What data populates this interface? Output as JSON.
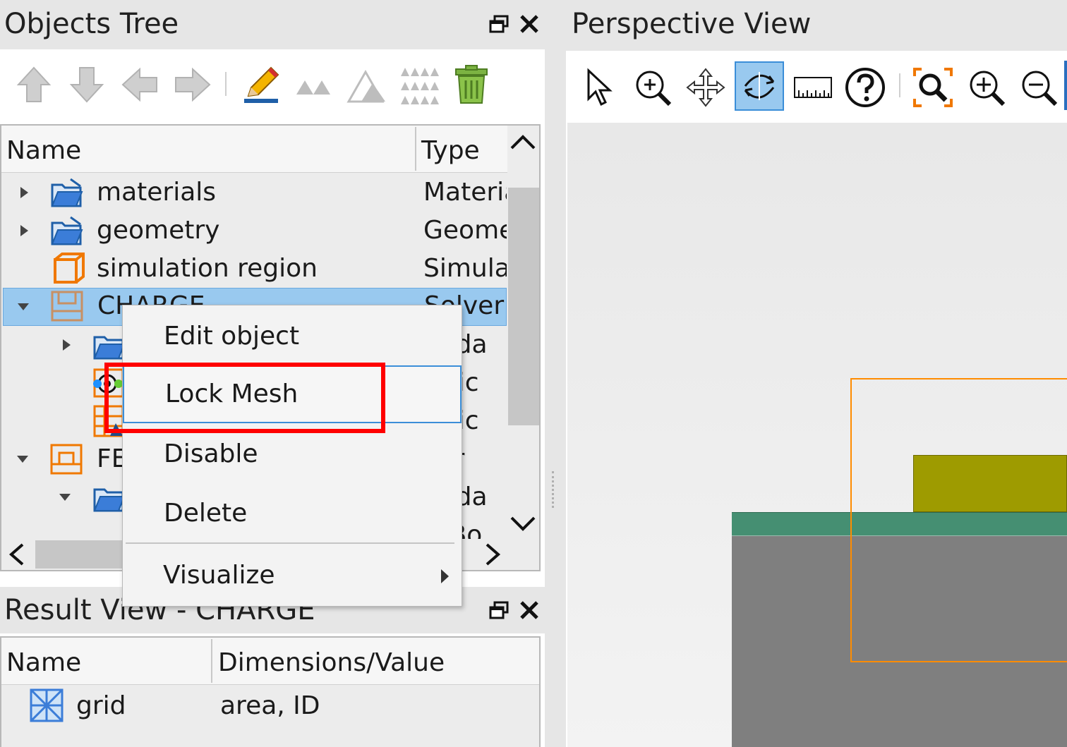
{
  "objects_tree": {
    "title": "Objects Tree",
    "toolbar": [
      {
        "icon": "arrow-up-icon"
      },
      {
        "icon": "arrow-down-icon"
      },
      {
        "icon": "arrow-left-icon"
      },
      {
        "icon": "arrow-right-icon"
      },
      {
        "icon": "edit-pencil-icon"
      },
      {
        "icon": "group-small-icon"
      },
      {
        "icon": "group-large-icon"
      },
      {
        "icon": "array-icon"
      },
      {
        "icon": "trash-icon"
      }
    ],
    "columns": {
      "name": "Name",
      "type": "Type"
    },
    "rows": [
      {
        "name": "materials",
        "type": "Materia"
      },
      {
        "name": "geometry",
        "type": "Geome"
      },
      {
        "name": "simulation region",
        "type": "Simula"
      },
      {
        "name": "CHARGE",
        "type": "Solver"
      },
      {
        "name": "",
        "type": "unda"
      },
      {
        "name": "",
        "type": "ctric"
      },
      {
        "name": "",
        "type": "ctric"
      },
      {
        "name": "FE",
        "type": "ver"
      },
      {
        "name": "",
        "type": "unda"
      },
      {
        "name": "",
        "type": "C Bo"
      }
    ]
  },
  "context_menu": {
    "items": [
      "Edit object",
      "Lock Mesh",
      "Disable",
      "Delete",
      "Visualize"
    ]
  },
  "result_view": {
    "title": "Result View - CHARGE",
    "columns": {
      "name": "Name",
      "value": "Dimensions/Value"
    },
    "rows": [
      {
        "name": "grid",
        "value": "area, ID"
      }
    ]
  },
  "perspective_view": {
    "title": "Perspective View",
    "toolbar": [
      {
        "icon": "select-pointer-icon"
      },
      {
        "icon": "zoom-region-icon"
      },
      {
        "icon": "pan-move-icon"
      },
      {
        "icon": "rotate-icon",
        "active": true
      },
      {
        "icon": "ruler-icon"
      },
      {
        "icon": "help-icon"
      },
      {
        "icon": "zoom-extent-icon"
      },
      {
        "icon": "zoom-in-icon"
      },
      {
        "icon": "zoom-out-icon"
      }
    ]
  },
  "colors": {
    "selection": "#99c9ef",
    "highlight_box": "#ff0000",
    "substrate": "#7f7f7f",
    "oxide_layer": "#458f72",
    "metal_layer": "#9e9b00",
    "sim_region": "#ff8c00"
  }
}
